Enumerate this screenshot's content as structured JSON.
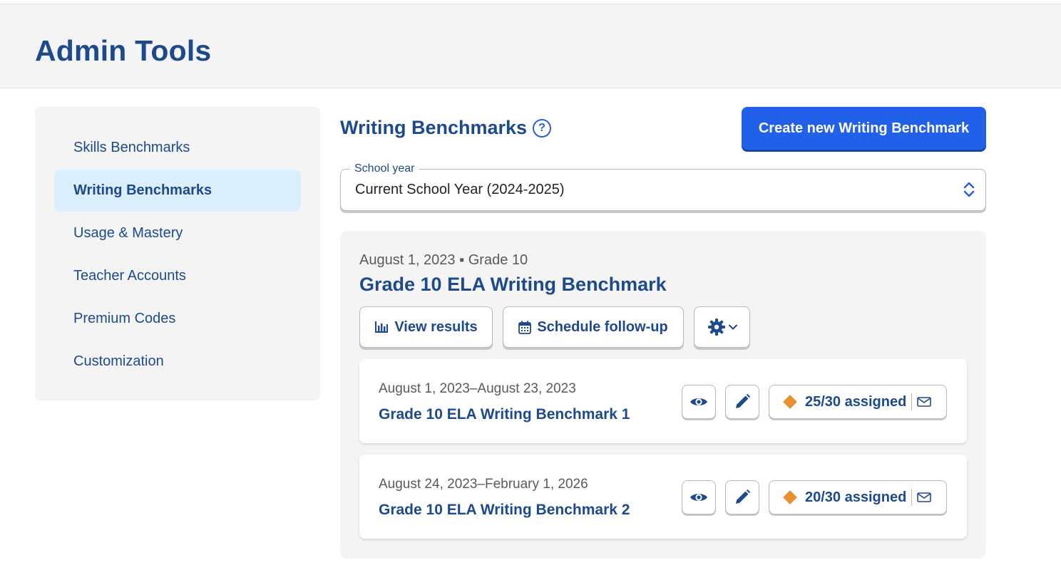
{
  "header": {
    "title": "Admin Tools"
  },
  "sidebar": {
    "items": [
      {
        "label": "Skills Benchmarks",
        "active": false
      },
      {
        "label": "Writing Benchmarks",
        "active": true
      },
      {
        "label": "Usage & Mastery",
        "active": false
      },
      {
        "label": "Teacher Accounts",
        "active": false
      },
      {
        "label": "Premium Codes",
        "active": false
      },
      {
        "label": "Customization",
        "active": false
      }
    ]
  },
  "main": {
    "title": "Writing Benchmarks",
    "help_icon": "question-circle-icon",
    "create_button": "Create new Writing Benchmark",
    "school_year": {
      "label": "School year",
      "value": "Current School Year (2024-2025)"
    },
    "benchmark": {
      "meta": "August 1, 2023 ▪ Grade 10",
      "title": "Grade 10 ELA Writing Benchmark",
      "view_results": "View results",
      "schedule_followup": "Schedule follow-up",
      "rows": [
        {
          "dates": "August 1, 2023–August 23, 2023",
          "title": "Grade 10 ELA Writing Benchmark 1",
          "assigned": "25/30 assigned"
        },
        {
          "dates": "August 24, 2023–February 1, 2026",
          "title": "Grade 10 ELA Writing Benchmark 2",
          "assigned": "20/30 assigned"
        }
      ]
    }
  },
  "colors": {
    "primary": "#2160e8",
    "navy": "#1d4a8c",
    "active_bg": "#dbeefb",
    "panel_bg": "#f4f4f4",
    "diamond": "#e8902f"
  }
}
